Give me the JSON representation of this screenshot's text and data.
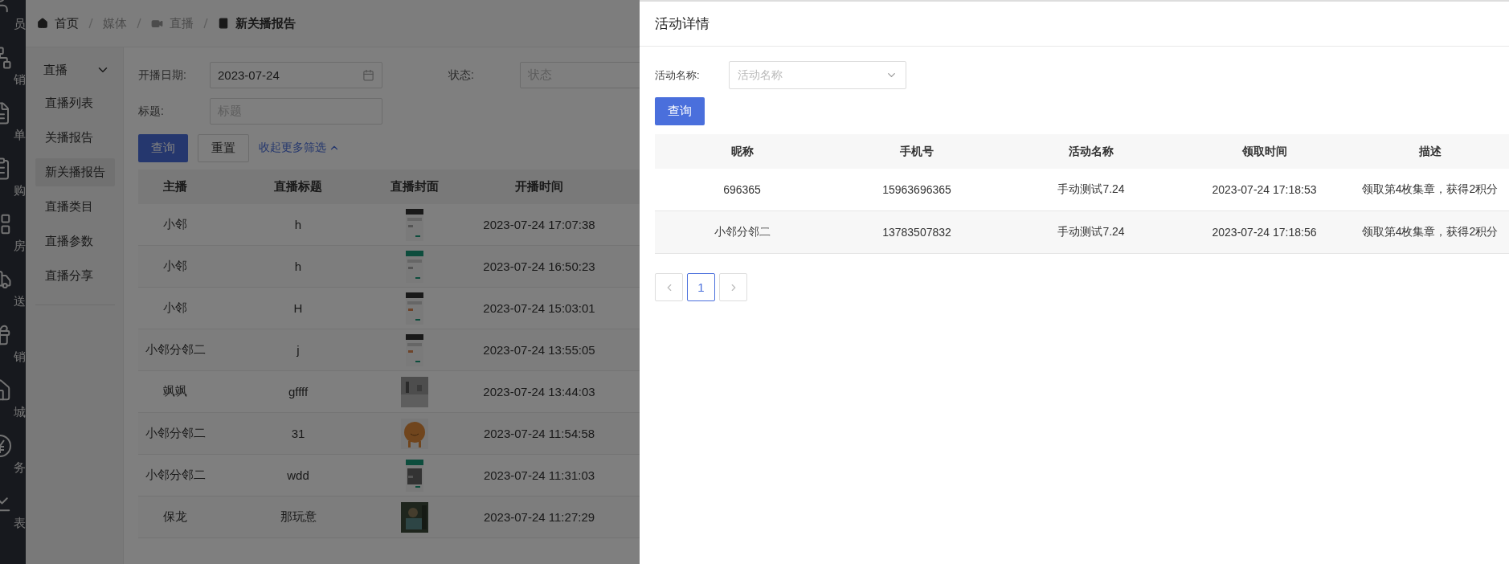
{
  "app_nav": {
    "items": [
      {
        "label": "员"
      },
      {
        "label": "销"
      },
      {
        "label": "单"
      },
      {
        "label": "购"
      },
      {
        "label": "房"
      },
      {
        "label": "送"
      },
      {
        "label": "销"
      },
      {
        "label": "城"
      },
      {
        "label": "务"
      },
      {
        "label": "表"
      }
    ]
  },
  "breadcrumb": [
    {
      "label": "首页",
      "kind": "link"
    },
    {
      "label": "媒体",
      "kind": "text"
    },
    {
      "label": "直播",
      "kind": "text"
    },
    {
      "label": "新关播报告",
      "kind": "current"
    }
  ],
  "submenu": {
    "group": {
      "label": "直播",
      "expanded": true
    },
    "items": [
      {
        "label": "直播列表",
        "selected": false
      },
      {
        "label": "关播报告",
        "selected": false
      },
      {
        "label": "新关播报告",
        "selected": true
      },
      {
        "label": "直播类目",
        "selected": false
      },
      {
        "label": "直播参数",
        "selected": false
      },
      {
        "label": "直播分享",
        "selected": false
      }
    ]
  },
  "filters": {
    "date": {
      "label": "开播日期:",
      "value": "2023-07-24"
    },
    "status": {
      "label": "状态:",
      "placeholder": "状态"
    },
    "title": {
      "label": "标题:",
      "placeholder": "标题"
    }
  },
  "actions": {
    "search": "查询",
    "reset": "重置",
    "collapse": "收起更多筛选"
  },
  "table": {
    "columns": [
      "主播",
      "直播标题",
      "直播封面",
      "开播时间"
    ],
    "rows": [
      {
        "anchor": "小邻",
        "title": "h",
        "time": "2023-07-24 17:07:38"
      },
      {
        "anchor": "小邻",
        "title": "h",
        "time": "2023-07-24 16:50:23"
      },
      {
        "anchor": "小邻",
        "title": "H",
        "time": "2023-07-24 15:03:01"
      },
      {
        "anchor": "小邻分邻二",
        "title": "j",
        "time": "2023-07-24 13:55:05"
      },
      {
        "anchor": "飒飒",
        "title": "gffff",
        "time": "2023-07-24 13:44:03"
      },
      {
        "anchor": "小邻分邻二",
        "title": "31",
        "time": "2023-07-24 11:54:58"
      },
      {
        "anchor": "小邻分邻二",
        "title": "wdd",
        "time": "2023-07-24 11:31:03"
      },
      {
        "anchor": "保龙",
        "title": "那玩意",
        "time": "2023-07-24 11:27:29"
      }
    ]
  },
  "drawer": {
    "title": "活动详情",
    "filter": {
      "label": "活动名称:",
      "placeholder": "活动名称"
    },
    "search": "查询",
    "table": {
      "columns": [
        "昵称",
        "手机号",
        "活动名称",
        "领取时间",
        "描述"
      ],
      "rows": [
        {
          "cells": [
            "696365",
            "15963696365",
            "手动测试7.24",
            "2023-07-24 17:18:53",
            "领取第4枚集章，获得2积分"
          ]
        },
        {
          "cells": [
            "小邻分邻二",
            "13783507832",
            "手动测试7.24",
            "2023-07-24 17:18:56",
            "领取第4枚集章，获得2积分"
          ]
        }
      ]
    },
    "pagination": {
      "pages": [
        {
          "label": "1",
          "selected": true
        }
      ]
    }
  }
}
